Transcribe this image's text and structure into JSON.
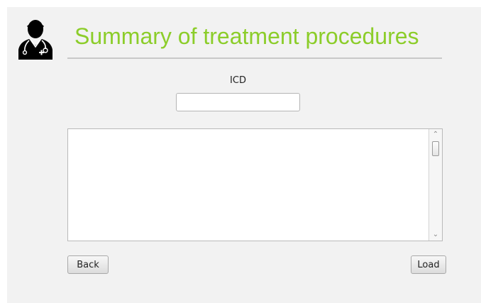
{
  "header": {
    "title": "Summary of treatment procedures",
    "icon": "doctor-icon",
    "title_color": "#8ccd2a"
  },
  "form": {
    "icd_label": "ICD",
    "icd_value": "",
    "results_text": ""
  },
  "buttons": {
    "back_label": "Back",
    "load_label": "Load"
  }
}
